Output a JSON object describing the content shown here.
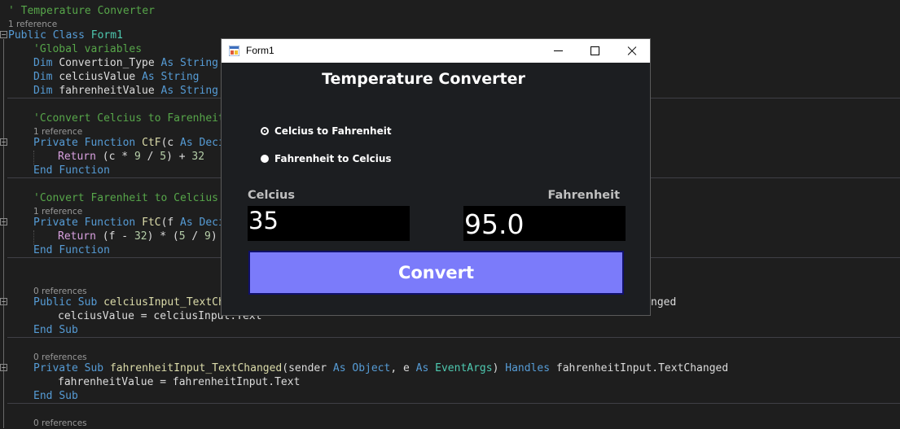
{
  "editor": {
    "header_comment": "' Temperature Converter",
    "refs": {
      "class_ref": "1 reference",
      "ctf_ref": "1 reference",
      "ftc_ref": "1 reference",
      "celsius_handler_ref": "0 references",
      "fahrenheit_handler_ref": "0 references",
      "bottom_ref": "0 references"
    },
    "class_line": {
      "kw1": "Public",
      "kw2": "Class",
      "name": "Form1"
    },
    "globals_comment": "'Global variables",
    "vars": [
      {
        "dim": "Dim",
        "name": "Convertion_Type",
        "as": "As",
        "type": "String"
      },
      {
        "dim": "Dim",
        "name": "celciusValue",
        "as": "As",
        "type": "String"
      },
      {
        "dim": "Dim",
        "name": "fahrenheitValue",
        "as": "As",
        "type": "String"
      }
    ],
    "ctf_comment": "'Cconvert Celcius to Farenheit",
    "ctf_sig": {
      "kw1": "Private",
      "kw2": "Function",
      "name": "CtF",
      "args": "(c ",
      "as": "As",
      "type": "Deci"
    },
    "ctf_return": {
      "kw": "Return",
      "expr1": " (c * ",
      "n1": "9",
      "expr2": " / ",
      "n2": "5",
      "expr3": ") + ",
      "n3": "32"
    },
    "end_function": {
      "kw1": "End",
      "kw2": "Function"
    },
    "ftc_comment": "'Convert Farenheit to Celcius",
    "ftc_sig": {
      "kw1": "Private",
      "kw2": "Function",
      "name": "FtC",
      "args": "(f ",
      "as": "As",
      "type": "Deci"
    },
    "ftc_return": {
      "kw": "Return",
      "expr1": " (f - ",
      "n1": "32",
      "expr2": ") * (",
      "n2": "5",
      "expr3": " / ",
      "n3": "9",
      "expr4": ")"
    },
    "celsius_handler": {
      "kw1": "Public",
      "kw2": "Sub",
      "name": "celciusInput_TextCha",
      "tail": "nged",
      "body": "celciusValue = celciusInput.Text"
    },
    "fahrenheit_handler": {
      "kw1": "Private",
      "kw2": "Sub",
      "name": "fahrenheitInput_TextChanged",
      "p1": "(sender ",
      "as1": "As",
      "t1": "Object",
      "p2": ", e ",
      "as2": "As",
      "t2": "EventArgs",
      "p3": ") ",
      "handles": "Handles",
      "target": " fahrenheitInput.TextChanged",
      "body": "fahrenheitValue = fahrenheitInput.Text"
    },
    "end_sub": {
      "kw1": "End",
      "kw2": "Sub"
    }
  },
  "form": {
    "window_title": "Form1",
    "heading": "Temperature Converter",
    "radio_ctf_label": "Celcius to Fahrenheit",
    "radio_ftc_label": "Fahrenheit to Celcius",
    "radio_selected": "ctf",
    "celsius_label": "Celcius",
    "fahrenheit_label": "Fahrenheit",
    "celsius_value": "35",
    "fahrenheit_value": "95.0",
    "convert_label": "Convert"
  }
}
